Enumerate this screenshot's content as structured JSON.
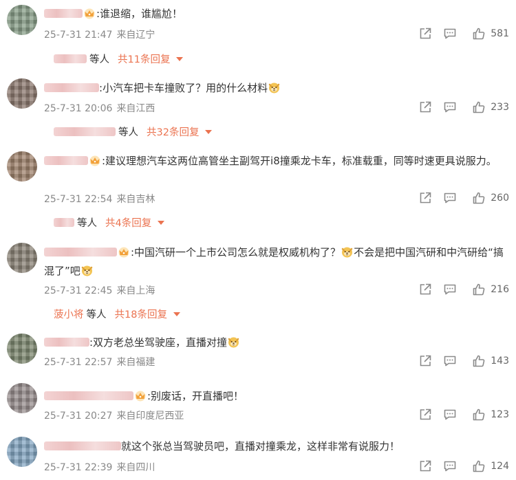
{
  "comments": [
    {
      "text": ":谁退缩，谁尴尬！",
      "date": "25-7-31 21:47",
      "location": "来自辽宁",
      "likes": "581",
      "replies": {
        "prefix": "",
        "suffix": "等人",
        "count": "共11条回复"
      },
      "avatar_color": "#8aa08a"
    },
    {
      "text": "小汽车把卡车撞败了？用的什么材料",
      "date": "25-7-31 20:06",
      "location": "来自江西",
      "likes": "233",
      "replies": {
        "prefix": "",
        "suffix": "等人",
        "count": "共32条回复"
      },
      "avatar_color": "#8d7a70"
    },
    {
      "text": ":建议理想汽车这两位高管坐主副驾开i8撞乘龙卡车，标准载重，同等时速更具说服力。",
      "date": "25-7-31 22:54",
      "location": "来自吉林",
      "likes": "260",
      "replies": {
        "prefix": "",
        "suffix": "等人",
        "count": "共4条回复"
      },
      "avatar_color": "#a2846e"
    },
    {
      "text_a": ":中国汽研一个上市公司怎么就是权威机构了？",
      "text_b": "不会是把中国汽研和中汽研给“搞混了”吧",
      "date": "25-7-31 22:45",
      "location": "来自上海",
      "likes": "216",
      "replies": {
        "prefix": "菠小将",
        "suffix": "等人",
        "count": "共18条回复"
      },
      "avatar_color": "#8c8478"
    },
    {
      "text": ":双方老总坐驾驶座，直播对撞",
      "date": "25-7-31 22:57",
      "location": "来自福建",
      "likes": "143",
      "avatar_color": "#7f8a72"
    },
    {
      "text": ":别废话，开直播吧！",
      "date": "25-7-31 20:27",
      "location": "来自印度尼西亚",
      "likes": "123",
      "avatar_color": "#9a9090"
    },
    {
      "text": "就这个张总当驾驶员吧，直播对撞乘龙，这样非常有说服力！",
      "date": "25-7-31 22:39",
      "location": "来自四川",
      "likes": "124",
      "avatar_color": "#86a8c4"
    }
  ]
}
